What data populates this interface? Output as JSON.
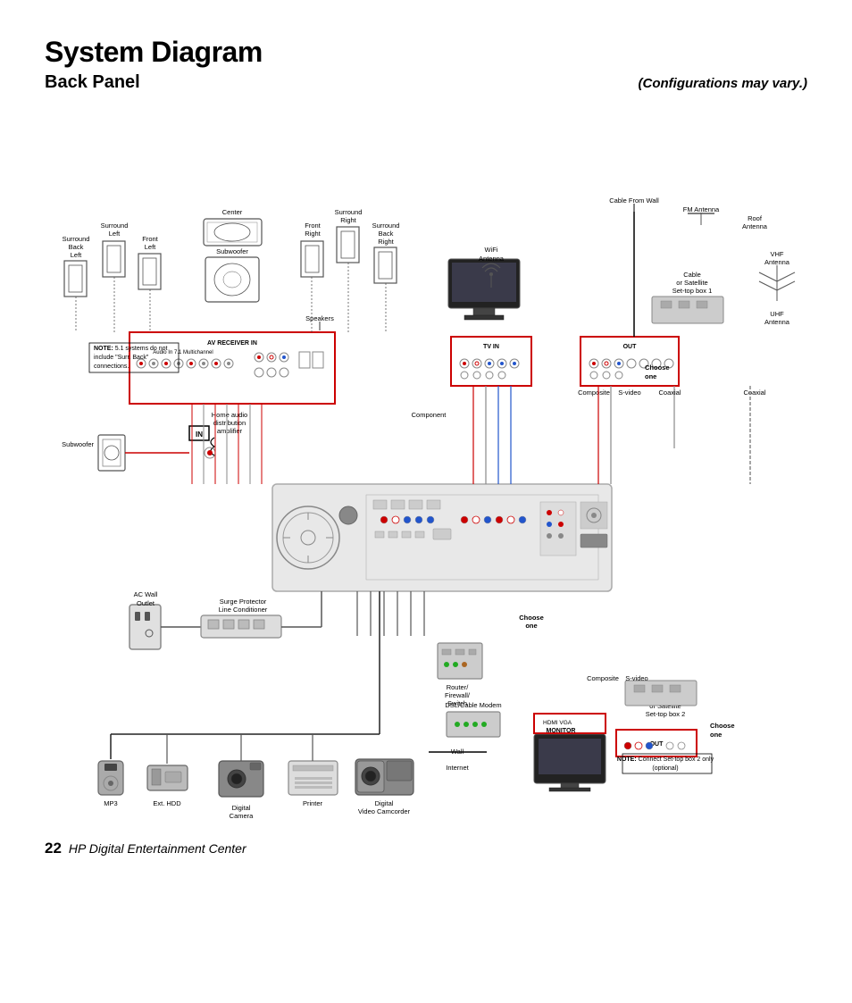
{
  "header": {
    "title": "System Diagram",
    "subtitle": "Back Panel",
    "config_note": "(Configurations may vary.)"
  },
  "footer": {
    "page_num": "22",
    "label": "HP Digital Entertainment Center"
  },
  "diagram": {
    "labels": {
      "cable_from_wall": "Cable From Wall",
      "fm_antenna": "FM Antenna",
      "roof_antenna": "Roof\nAntenna",
      "vhf_antenna": "VHF\nAntenna",
      "uhf_antenna": "UHF\nAntenna",
      "wifi_antenna": "WiFi\nAntenna",
      "cable_satellite_1": "Cable\nor Satellite\nSet-top box 1",
      "cable_satellite_2": "Cable\nor Satellite\nSet-top box 2",
      "surround_back_left": "Surround\nBack\nLeft",
      "surround_left": "Surround\nLeft",
      "center": "Center",
      "front_right": "Front\nRight",
      "surround_right": "Surround\nRight",
      "surround_back_right": "Surround\nBack\nRight",
      "front_left": "Front\nLeft",
      "subwoofer_top": "Subwoofer",
      "speakers": "Speakers",
      "av_receiver_in": "AV RECEIVER IN",
      "tv_in": "TV IN",
      "out": "OUT",
      "component": "Component",
      "composite": "Composite",
      "s_video": "S-video",
      "coaxial": "Coaxial",
      "choose_one": "Choose\none",
      "choose_one2": "Choose\none",
      "choose_one3": "Choose\none",
      "in_label": "IN",
      "home_audio": "Home audio\ndistribution\namplifier",
      "subwoofer_side": "Subwoofer",
      "note_51": "NOTE:  5.1 systems do not\ninclude \"Surr. Back\"\nconnections.",
      "note_settop2": "NOTE: Connect Set-top box 2 only\n(optional)",
      "ac_wall_outlet": "AC Wall\nOutlet",
      "surge_protector": "Surge Protector\nLine Conditioner",
      "router": "Router/\nFirewall/\nSwitch",
      "dsl_cable_modem": "DSL/Cable Modem",
      "wall": "Wall",
      "internet": "Internet",
      "monitor": "MONITOR",
      "hdmi_vga": "HDMI  VGA",
      "mp3": "MP3",
      "ext_hdd": "Ext. HDD",
      "digital_camera": "Digital\nCamera",
      "printer": "Printer",
      "digital_camcorder": "Digital\nVideo Camcorder"
    }
  }
}
